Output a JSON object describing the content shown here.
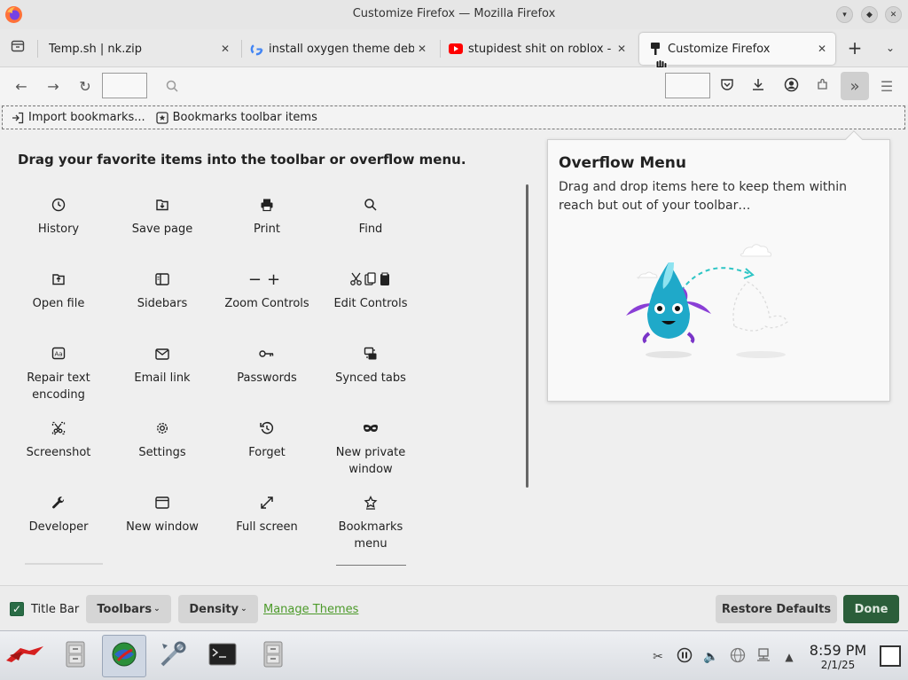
{
  "window": {
    "title": "Customize Firefox — Mozilla Firefox",
    "controls": [
      "minimize",
      "maximize",
      "close"
    ]
  },
  "tabs": [
    {
      "label": "Temp.sh | nk.zip",
      "icon": "none"
    },
    {
      "label": "install oxygen theme debia",
      "icon": "google-icon"
    },
    {
      "label": "stupidest shit on roblox - Y",
      "icon": "youtube-icon"
    },
    {
      "label": "Customize Firefox",
      "icon": "paintbrush-icon",
      "active": true
    }
  ],
  "bookmarks_bar": {
    "items": [
      "Import bookmarks...",
      "Bookmarks toolbar items"
    ]
  },
  "palette": {
    "title": "Drag your favorite items into the toolbar or overflow menu.",
    "items": [
      {
        "label": "History",
        "icon": "clock-icon"
      },
      {
        "label": "Save page",
        "icon": "save-page-icon"
      },
      {
        "label": "Print",
        "icon": "printer-icon"
      },
      {
        "label": "Find",
        "icon": "search-icon"
      },
      {
        "label": "Open file",
        "icon": "open-file-icon"
      },
      {
        "label": "Sidebars",
        "icon": "sidebar-icon"
      },
      {
        "label": "Zoom Controls",
        "icon": "zoom-icon"
      },
      {
        "label": "Edit Controls",
        "icon": "edit-controls-icon"
      },
      {
        "label": "Repair text encoding",
        "icon": "encoding-icon"
      },
      {
        "label": "Email link",
        "icon": "envelope-icon"
      },
      {
        "label": "Passwords",
        "icon": "key-icon"
      },
      {
        "label": "Synced tabs",
        "icon": "synced-tabs-icon"
      },
      {
        "label": "Screenshot",
        "icon": "scissors-icon"
      },
      {
        "label": "Settings",
        "icon": "gear-icon"
      },
      {
        "label": "Forget",
        "icon": "forget-icon"
      },
      {
        "label": "New private window",
        "icon": "mask-icon"
      },
      {
        "label": "Developer",
        "icon": "wrench-icon"
      },
      {
        "label": "New window",
        "icon": "window-icon"
      },
      {
        "label": "Full screen",
        "icon": "fullscreen-icon"
      },
      {
        "label": "Bookmarks menu",
        "icon": "bookmark-star-icon"
      }
    ]
  },
  "overflow_panel": {
    "title": "Overflow Menu",
    "description": "Drag and drop items here to keep them within reach but out of your toolbar…"
  },
  "bottom_bar": {
    "title_bar_label": "Title Bar",
    "title_bar_checked": true,
    "toolbars_label": "Toolbars",
    "density_label": "Density",
    "manage_themes_label": "Manage Themes",
    "restore_label": "Restore Defaults",
    "done_label": "Done"
  },
  "taskbar": {
    "time": "8:59 PM",
    "date": "2/1/25"
  },
  "colors": {
    "accent_green": "#2a6c46",
    "link_green": "#4c9a2a",
    "done_bg": "#2b5e3a"
  }
}
